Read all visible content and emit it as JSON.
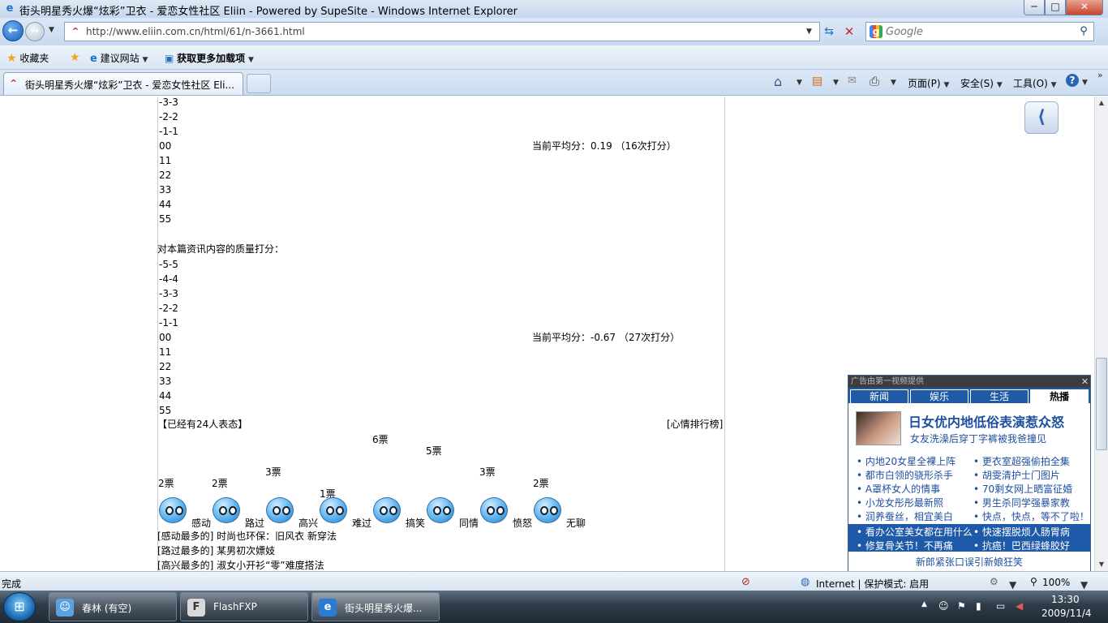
{
  "window": {
    "title": "街头明星秀火爆“炫彩”卫衣 - 爱恋女性社区 Eliin - Powered by SupeSite - Windows Internet Explorer",
    "min": "─",
    "max": "□",
    "close": "✕"
  },
  "nav": {
    "back": "←",
    "forward": "→",
    "url": "http://www.eliin.com.cn/html/61/n-3661.html",
    "search_placeholder": "Google"
  },
  "favbar": {
    "favorites": "收藏夹",
    "suggested": "建议网站",
    "addons": "获取更多加载项"
  },
  "tabs": {
    "active": "街头明星秀火爆“炫彩”卫衣 - 爱恋女性社区 Eli..."
  },
  "commandbar": {
    "page": "页面(P)",
    "safety": "安全(S)",
    "tools": "工具(O)"
  },
  "content": {
    "options_top": [
      "-3-3",
      "-2-2",
      "-1-1",
      "00",
      "11",
      "22",
      "33",
      "44",
      "55"
    ],
    "avg_top": "当前平均分：0.19 （16次打分）",
    "quality_label": "对本篇资讯内容的质量打分：",
    "options_quality": [
      "-5-5",
      "-4-4",
      "-3-3",
      "-2-2",
      "-1-1",
      "00",
      "11",
      "22",
      "33",
      "44",
      "55"
    ],
    "avg_quality": "当前平均分：-0.67 （27次打分）",
    "mood_count": "【已经有24人表态】",
    "mood_rank": "[心情排行榜]",
    "moods": [
      {
        "label": "感动",
        "votes": "2票"
      },
      {
        "label": "路过",
        "votes": "2票"
      },
      {
        "label": "高兴",
        "votes": "3票"
      },
      {
        "label": "难过",
        "votes": "1票"
      },
      {
        "label": "搞笑",
        "votes": "6票"
      },
      {
        "label": "同情",
        "votes": "5票"
      },
      {
        "label": "愤怒",
        "votes": "3票"
      },
      {
        "label": "无聊",
        "votes": "2票"
      }
    ],
    "most": [
      "[感动最多的] 时尚也环保：旧风衣 新穿法",
      "[路过最多的] 某男初次嫖妓",
      "[高兴最多的] 淑女小开衫“零”难度搭法"
    ]
  },
  "ad": {
    "header": "广告由第一视频提供",
    "close": "✕",
    "tabs": [
      "新闻",
      "娱乐",
      "生活",
      "热播"
    ],
    "headline": "日女优内地低俗表演惹众怒",
    "sub": "女友洗澡后穿丁字裤被我爸撞见",
    "links_left": [
      "内地20女星全裸上阵",
      "都市白领的骁形杀手",
      "A罩杯女人的情事",
      "小龙女彤彤最新照",
      "润养蚕丝，相宜美白",
      "看办公室美女都在用什么",
      "修复骨关节！不再痛"
    ],
    "links_right": [
      "更衣室超强偷拍全集",
      "胡雯清护士门图片",
      "70剩女网上晒富征婚",
      "男生杀同学强暴家教",
      "快点，快点，等不了啦！",
      "快速摆脱烦人肠胃病",
      "抗癌！巴西绿蜂胶好"
    ],
    "bottom": "新郎紧张口误引新娘狂笑"
  },
  "status": {
    "left": "完成",
    "zone": "Internet | 保护模式: 启用",
    "zoom": "100%"
  },
  "taskbar": {
    "start": "⊞",
    "tasks": [
      "春林 (有空)",
      "FlashFXP",
      "街头明星秀火爆..."
    ],
    "time": "13:30",
    "date": "2009/11/4"
  }
}
